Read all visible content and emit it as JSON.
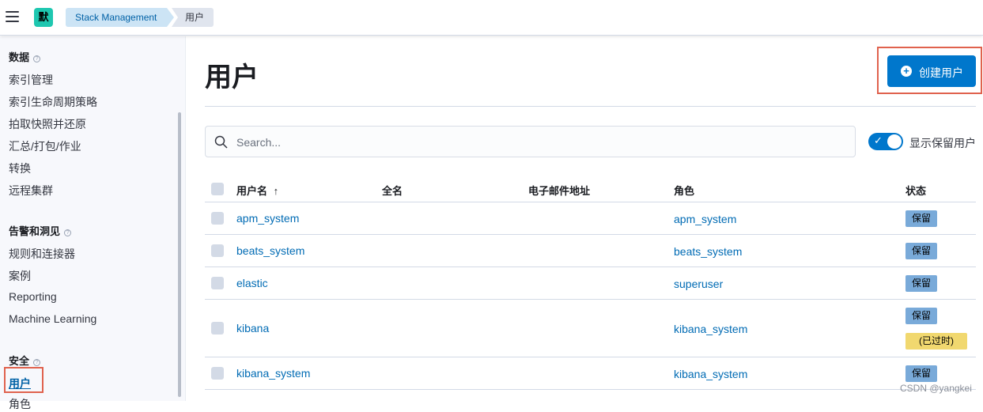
{
  "header": {
    "space_initial": "默",
    "breadcrumbs": [
      "Stack Management",
      "用户"
    ]
  },
  "sidebar": {
    "groups": [
      {
        "title": "数据",
        "items": [
          "索引管理",
          "索引生命周期策略",
          "拍取快照并还原",
          "汇总/打包/作业",
          "转换",
          "远程集群"
        ]
      },
      {
        "title": "告警和洞见",
        "items": [
          "规则和连接器",
          "案例",
          "Reporting",
          "Machine Learning"
        ]
      },
      {
        "title": "安全",
        "items": [
          "用户",
          "角色"
        ]
      }
    ],
    "active_item": "用户",
    "help_icon": "?"
  },
  "main": {
    "title": "用户",
    "create_button": "创建用户",
    "search_placeholder": "Search...",
    "toggle_label": "显示保留用户",
    "toggle_on": true,
    "columns": [
      "用户名",
      "全名",
      "电子邮件地址",
      "角色",
      "状态"
    ],
    "sort_indicator": "↑",
    "rows": [
      {
        "username": "apm_system",
        "roles": "apm_system",
        "badges": [
          "保留"
        ]
      },
      {
        "username": "beats_system",
        "roles": "beats_system",
        "badges": [
          "保留"
        ]
      },
      {
        "username": "elastic",
        "roles": "superuser",
        "badges": [
          "保留"
        ]
      },
      {
        "username": "kibana",
        "roles": "kibana_system",
        "badges": [
          "保留",
          "(已过时)"
        ]
      },
      {
        "username": "kibana_system",
        "roles": "kibana_system",
        "badges": [
          "保留"
        ]
      }
    ]
  },
  "watermark": "CSDN @yangkei",
  "colors": {
    "primary": "#0077cc",
    "link": "#006bb4",
    "reserved_badge": "#79aad9",
    "deprecated_badge": "#f1d86f",
    "highlight_box": "#e0624e"
  }
}
